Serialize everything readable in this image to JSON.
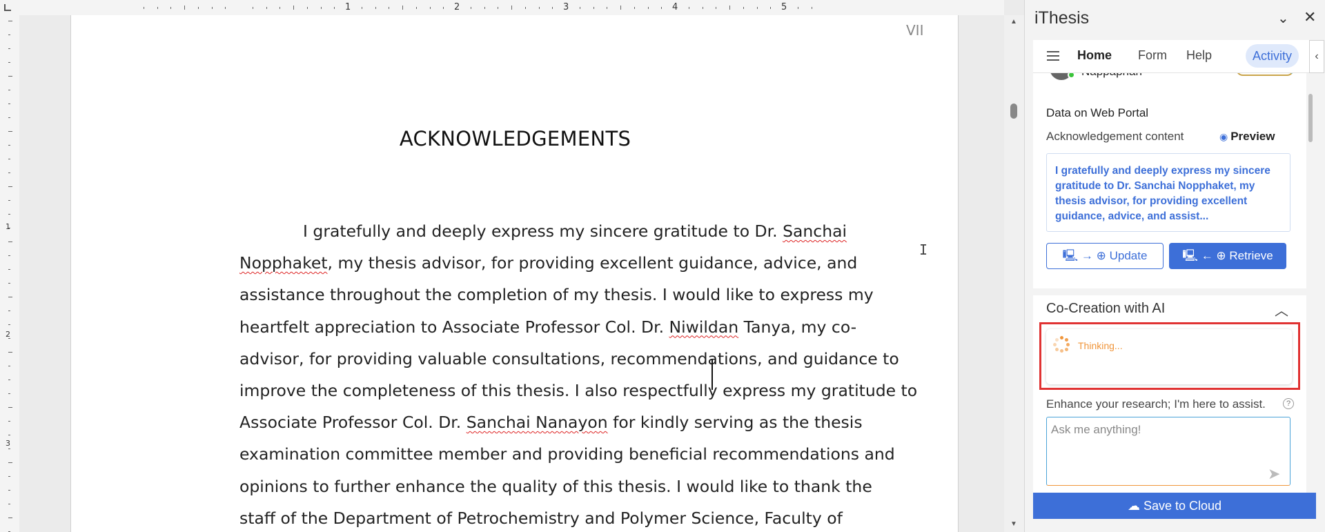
{
  "document": {
    "page_number": "VII",
    "title": "ACKNOWLEDGEMENTS",
    "ruler_numbers": [
      "1",
      "2",
      "3",
      "4",
      "5"
    ],
    "vertical_ruler_numbers": [
      "1",
      "2",
      "3"
    ],
    "body_lines": [
      [
        {
          "t": "I gratefully and deeply express my sincere gratitude to Dr. "
        },
        {
          "t": "Sanchai",
          "err": true
        }
      ],
      [
        {
          "t": "Nopphaket",
          "err": true
        },
        {
          "t": ", my thesis advisor, for providing excellent guidance, advice, and"
        }
      ],
      [
        {
          "t": "assistance throughout the completion of my thesis. I would like to express my"
        }
      ],
      [
        {
          "t": "heartfelt appreciation to Associate Professor Col. Dr. "
        },
        {
          "t": "Niwildan",
          "err": true
        },
        {
          "t": " Tanya, my co-"
        }
      ],
      [
        {
          "t": "advisor, for providing valuable consultations, recommendations, and guidance to"
        }
      ],
      [
        {
          "t": "improve the completeness of this thesis. I also respectfully express my gratitude to"
        }
      ],
      [
        {
          "t": "Associate Professor Col. Dr. "
        },
        {
          "t": "Sanchai Nanayon",
          "err": true
        },
        {
          "t": " for kindly serving as the thesis"
        }
      ],
      [
        {
          "t": "examination committee member and providing beneficial recommendations and"
        }
      ],
      [
        {
          "t": "opinions to further enhance the quality of this thesis. I would like to thank the"
        }
      ],
      [
        {
          "t": "staff of the Department of Petrochemistry and Polymer Science, Faculty of"
        }
      ]
    ]
  },
  "panel": {
    "title": "iThesis",
    "nav": {
      "home": "Home",
      "form": "Form",
      "help": "Help",
      "activity": "Activity"
    },
    "user_name": "Nappaphan",
    "portal_heading": "Data on Web Portal",
    "ack_label": "Acknowledgement content",
    "preview_label": "Preview",
    "ack_preview": "I gratefully and deeply express my sincere gratitude to Dr. Sanchai Nopphaket, my thesis advisor, for providing excellent guidance, advice, and assist...",
    "update_label": "Update",
    "retrieve_label": "Retrieve",
    "ai_heading": "Co-Creation with AI",
    "thinking": "Thinking...",
    "assist_text": "Enhance your research; I'm here to assist.",
    "ask_placeholder": "Ask me anything!",
    "save_label": "Save to Cloud"
  },
  "colors": {
    "accent": "#3d6fd8",
    "thinking": "#f0953a",
    "highlight": "#e03232",
    "spellcheck": "#d22222"
  },
  "icons": {
    "menu": "hamburger-icon",
    "collapse": "chevron-down-icon",
    "close": "close-icon",
    "preview": "eye-icon",
    "update": "computer-to-globe-icon",
    "retrieve": "globe-to-computer-icon",
    "ai_toggle": "chevron-up-icon",
    "help": "question-circle-icon",
    "send": "send-icon",
    "save": "cloud-upload-icon"
  }
}
